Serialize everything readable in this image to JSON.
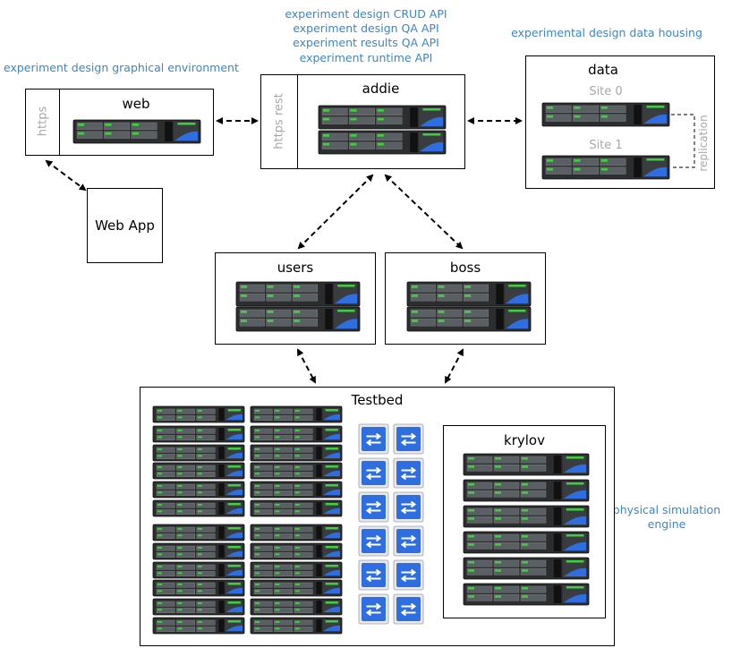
{
  "captions": {
    "graphical_env": "experiment design graphical environment",
    "api_lines": [
      "experiment design CRUD API",
      "experiment design QA API",
      "experiment results QA API",
      "experiment runtime API"
    ],
    "data_housing": "experimental design data housing",
    "physical_sim": [
      "physical simulation",
      "engine"
    ]
  },
  "nodes": {
    "web": {
      "title": "web",
      "protocol": "https"
    },
    "addie": {
      "title": "addie",
      "protocol": "https rest"
    },
    "data": {
      "title": "data",
      "sites": [
        "Site 0",
        "Site 1"
      ],
      "link_label": "replication"
    },
    "webapp": {
      "title": "Web App"
    },
    "users": {
      "title": "users"
    },
    "boss": {
      "title": "boss"
    },
    "testbed": {
      "title": "Testbed"
    },
    "krylov": {
      "title": "krylov"
    }
  },
  "colors": {
    "caption_blue": "#3a87cf",
    "server_dark": "#2b2d2e",
    "led_green": "#3ecf3e",
    "switch_blue": "#2f6ee0",
    "muted_text": "#a8a8a8"
  },
  "icons": {
    "server": "rack-server-icon",
    "switch": "network-switch-icon"
  }
}
